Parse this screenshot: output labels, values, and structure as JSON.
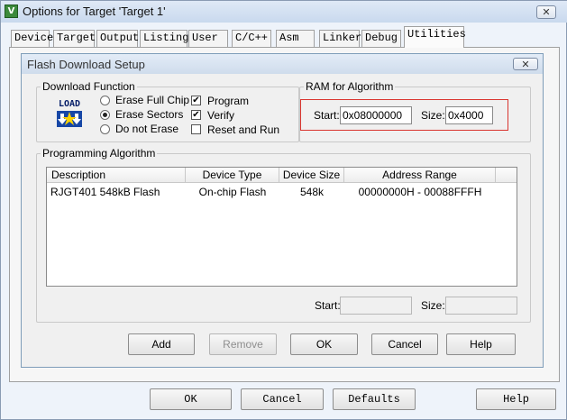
{
  "window": {
    "title": "Options for Target 'Target 1'",
    "close_glyph": "✕",
    "icon_letter": "V"
  },
  "tabs": [
    {
      "label": "Device"
    },
    {
      "label": "Target"
    },
    {
      "label": "Output"
    },
    {
      "label": "Listing"
    },
    {
      "label": "User"
    },
    {
      "label": "C/C++"
    },
    {
      "label": "Asm"
    },
    {
      "label": "Linker"
    },
    {
      "label": "Debug"
    },
    {
      "label": "Utilities",
      "active": true
    }
  ],
  "dialog": {
    "title": "Flash Download Setup",
    "close_glyph": "✕",
    "download_function": {
      "legend": "Download Function",
      "icon_text": "LOAD",
      "radios": [
        {
          "label": "Erase Full Chip",
          "checked": false
        },
        {
          "label": "Erase Sectors",
          "checked": true
        },
        {
          "label": "Do not Erase",
          "checked": false
        }
      ],
      "checks": [
        {
          "label": "Program",
          "checked": true
        },
        {
          "label": "Verify",
          "checked": true
        },
        {
          "label": "Reset and Run",
          "checked": false
        }
      ]
    },
    "ram": {
      "legend": "RAM for Algorithm",
      "start_label": "Start:",
      "start_value": "0x08000000",
      "size_label": "Size:",
      "size_value": "0x4000"
    },
    "algorithm": {
      "legend": "Programming Algorithm",
      "columns": [
        "Description",
        "Device Type",
        "Device Size",
        "Address Range"
      ],
      "rows": [
        {
          "description": "RJGT401 548kB Flash",
          "device_type": "On-chip Flash",
          "device_size": "548k",
          "address_range": "00000000H - 00088FFFH"
        }
      ],
      "start_label": "Start:",
      "size_label": "Size:"
    },
    "buttons": {
      "add": "Add",
      "remove": "Remove",
      "ok": "OK",
      "cancel": "Cancel",
      "help": "Help"
    }
  },
  "footer": {
    "ok": "OK",
    "cancel": "Cancel",
    "defaults": "Defaults",
    "help": "Help"
  },
  "colors": {
    "highlight_border": "#d9352f"
  }
}
